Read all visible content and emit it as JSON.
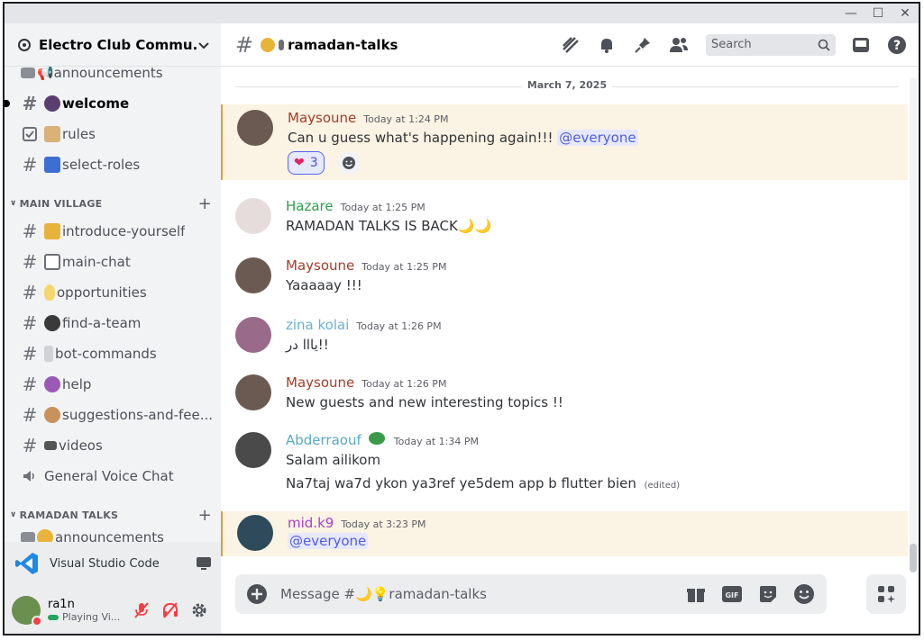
{
  "window": {
    "minimize": "—",
    "maximize": "☐",
    "close": "✕"
  },
  "server": {
    "name": "Electro Club Commu..."
  },
  "sidebar": {
    "channels_top": [
      {
        "label": "📢announcements"
      },
      {
        "label": "welcome"
      },
      {
        "label": "rules"
      },
      {
        "label": "select-roles"
      }
    ],
    "category_main": "MAIN VILLAGE",
    "channels_main": [
      {
        "label": "introduce-yourself"
      },
      {
        "label": "main-chat"
      },
      {
        "label": "opportunities"
      },
      {
        "label": "find-a-team"
      },
      {
        "label": "bot-commands"
      },
      {
        "label": "help"
      },
      {
        "label": "suggestions-and-fee..."
      },
      {
        "label": "videos"
      },
      {
        "label": "General Voice Chat"
      }
    ],
    "category_ramadan": "RAMADAN TALKS",
    "channels_ramadan": [
      {
        "label": "announcements"
      }
    ]
  },
  "activity": {
    "label": "Visual Studio Code"
  },
  "user": {
    "name": "ra1n",
    "status": "Playing Vi..."
  },
  "channel": {
    "name": "ramadan-talks"
  },
  "search": {
    "placeholder": "Search"
  },
  "date_divider": "March 7, 2025",
  "messages": [
    {
      "author": "Maysoune",
      "time": "Today at 1:24 PM",
      "text": "Can u guess what's happening again!!!",
      "mention": "@everyone",
      "reaction_count": "3"
    },
    {
      "author": "Hazare",
      "time": "Today at 1:25 PM",
      "text": "RAMADAN TALKS IS BACK🌙🌙"
    },
    {
      "author": "Maysoune",
      "time": "Today at 1:25 PM",
      "text": "Yaaaaay !!!"
    },
    {
      "author": "zina kolai",
      "time": "Today at 1:26 PM",
      "text": "يااا در!!"
    },
    {
      "author": "Maysoune",
      "time": "Today at 1:26 PM",
      "text": "New guests and new interesting topics !!"
    },
    {
      "author": "Abderraouf",
      "time": "Today at 1:34 PM",
      "text": "Salam ailikom",
      "text2": "Na7taj wa7d ykon ya3ref ye5dem app b flutter bien",
      "edited": "(edited)"
    },
    {
      "author": "mid.k9",
      "time": "Today at 3:23 PM",
      "mention": "@everyone"
    }
  ],
  "composer": {
    "placeholder": "Message #🌙💡ramadan-talks"
  },
  "colors": {
    "maysoune": "#a23e2a",
    "hazare": "#2e9e4a",
    "zina": "#6ab0d6",
    "abderraouf": "#5aa8c4",
    "midk9": "#a83ecf",
    "highlight": "#fbf3e3"
  }
}
